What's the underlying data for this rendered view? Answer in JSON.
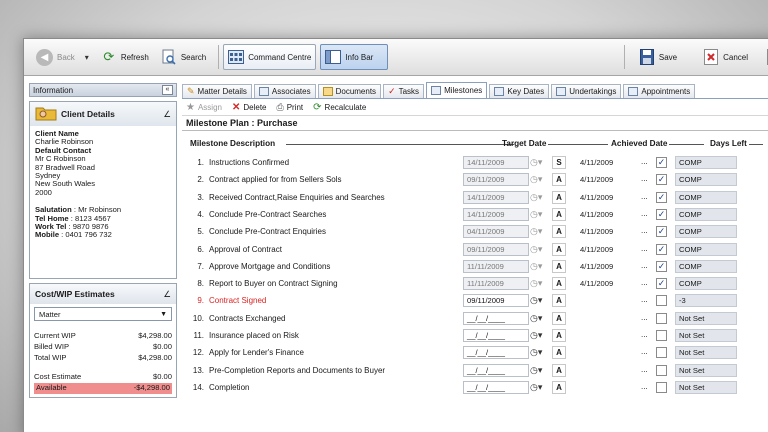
{
  "toolbar": {
    "back": "Back",
    "refresh": "Refresh",
    "search": "Search",
    "command_centre": "Command Centre",
    "info_bar": "Info Bar",
    "save": "Save",
    "cancel": "Cancel"
  },
  "info_panel": {
    "title": "Information",
    "collapse": "«"
  },
  "client_details": {
    "title": "Client Details",
    "client_name_label": "Client Name",
    "client_name": "Charlie Robinson",
    "default_contact_label": "Default Contact",
    "contact_name": "Mr C Robinson",
    "address_1": "87 Bradwell Road",
    "address_2": "Sydney",
    "address_3": "New South Wales",
    "address_4": "2000",
    "salutation_label": "Salutation",
    "salutation": ": Mr Robinson",
    "tel_home_label": "Tel Home",
    "tel_home": ": 8123 4567",
    "work_tel_label": "Work Tel",
    "work_tel": ": 9870 9876",
    "mobile_label": "Mobile",
    "mobile": ": 0401 796 732"
  },
  "wip": {
    "title": "Cost/WIP Estimates",
    "selected": "Matter",
    "rows": [
      {
        "label": "Current WIP",
        "value": "$4,298.00"
      },
      {
        "label": "Billed WIP",
        "value": "$0.00"
      },
      {
        "label": "Total WIP",
        "value": "$4,298.00"
      }
    ],
    "cost_estimate_label": "Cost Estimate",
    "cost_estimate": "$0.00",
    "available_label": "Available",
    "available": "-$4,298.00"
  },
  "tabs": [
    {
      "label": "Matter Details"
    },
    {
      "label": "Associates"
    },
    {
      "label": "Documents"
    },
    {
      "label": "Tasks"
    },
    {
      "label": "Milestones"
    },
    {
      "label": "Key Dates"
    },
    {
      "label": "Undertakings"
    },
    {
      "label": "Appointments"
    }
  ],
  "actions": {
    "assign": "Assign",
    "delete": "Delete",
    "print": "Print",
    "recalculate": "Recalculate"
  },
  "plan_title": "Milestone Plan : Purchase",
  "columns": {
    "description": "Milestone Description",
    "target": "Target Date",
    "achieved": "Achieved Date",
    "days": "Days Left"
  },
  "milestones": [
    {
      "num": "1.",
      "desc": "Instructions Confirmed",
      "target": "14/11/2009",
      "code": "S",
      "achieved": "4/11/2009",
      "dots": "...",
      "checked": "✓",
      "days": "COMP",
      "red": false,
      "enabled": false
    },
    {
      "num": "2.",
      "desc": "Contract applied for from Sellers Sols",
      "target": "09/11/2009",
      "code": "A",
      "achieved": "4/11/2009",
      "dots": "...",
      "checked": "✓",
      "days": "COMP",
      "red": false,
      "enabled": false
    },
    {
      "num": "3.",
      "desc": "Received Contract,Raise Enquiries and Searches",
      "target": "14/11/2009",
      "code": "A",
      "achieved": "4/11/2009",
      "dots": "...",
      "checked": "✓",
      "days": "COMP",
      "red": false,
      "enabled": false
    },
    {
      "num": "4.",
      "desc": "Conclude Pre-Contract Searches",
      "target": "14/11/2009",
      "code": "A",
      "achieved": "4/11/2009",
      "dots": "...",
      "checked": "✓",
      "days": "COMP",
      "red": false,
      "enabled": false
    },
    {
      "num": "5.",
      "desc": "Conclude Pre-Contract Enquiries",
      "target": "04/11/2009",
      "code": "A",
      "achieved": "4/11/2009",
      "dots": "...",
      "checked": "✓",
      "days": "COMP",
      "red": false,
      "enabled": false
    },
    {
      "num": "6.",
      "desc": "Approval of Contract",
      "target": "09/11/2009",
      "code": "A",
      "achieved": "4/11/2009",
      "dots": "...",
      "checked": "✓",
      "days": "COMP",
      "red": false,
      "enabled": false
    },
    {
      "num": "7.",
      "desc": "Approve Mortgage and Conditions",
      "target": "11/11/2009",
      "code": "A",
      "achieved": "4/11/2009",
      "dots": "...",
      "checked": "✓",
      "days": "COMP",
      "red": false,
      "enabled": false
    },
    {
      "num": "8.",
      "desc": "Report to Buyer on Contract Signing",
      "target": "11/11/2009",
      "code": "A",
      "achieved": "4/11/2009",
      "dots": "...",
      "checked": "✓",
      "days": "COMP",
      "red": false,
      "enabled": false
    },
    {
      "num": "9.",
      "desc": "Contract Signed",
      "target": "09/11/2009",
      "code": "A",
      "achieved": "",
      "dots": "...",
      "checked": "",
      "days": "-3",
      "red": true,
      "enabled": true
    },
    {
      "num": "10.",
      "desc": "Contracts Exchanged",
      "target": "__/__/____",
      "code": "A",
      "achieved": "",
      "dots": "...",
      "checked": "",
      "days": "Not Set",
      "red": false,
      "enabled": true
    },
    {
      "num": "11.",
      "desc": "Insurance placed on Risk",
      "target": "__/__/____",
      "code": "A",
      "achieved": "",
      "dots": "...",
      "checked": "",
      "days": "Not Set",
      "red": false,
      "enabled": true
    },
    {
      "num": "12.",
      "desc": "Apply for Lender's Finance",
      "target": "__/__/____",
      "code": "A",
      "achieved": "",
      "dots": "...",
      "checked": "",
      "days": "Not Set",
      "red": false,
      "enabled": true
    },
    {
      "num": "13.",
      "desc": "Pre-Completion Reports and Documents to Buyer",
      "target": "__/__/____",
      "code": "A",
      "achieved": "",
      "dots": "...",
      "checked": "",
      "days": "Not Set",
      "red": false,
      "enabled": true
    },
    {
      "num": "14.",
      "desc": "Completion",
      "target": "__/__/____",
      "code": "A",
      "achieved": "",
      "dots": "...",
      "checked": "",
      "days": "Not Set",
      "red": false,
      "enabled": true
    }
  ]
}
